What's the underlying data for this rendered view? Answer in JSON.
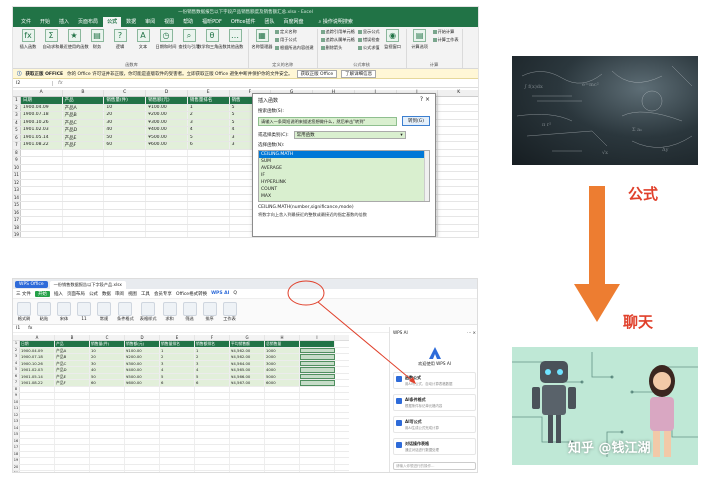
{
  "excel": {
    "title": "一份销售数据报告以下字段产品销售额度及销售额汇总.xlsx - Excel",
    "tabs": [
      "文件",
      "开始",
      "插入",
      "页面布局",
      "公式",
      "数据",
      "审阅",
      "视图",
      "帮助",
      "福昕PDF",
      "Office插件",
      "团队",
      "百度网盘"
    ],
    "active_tab": "公式",
    "search_label": "操作说明搜索",
    "ribbon": {
      "big_buttons": [
        {
          "icon": "fx",
          "label": "插入函数"
        },
        {
          "icon": "Σ",
          "label": "自动求和"
        },
        {
          "icon": "★",
          "label": "最近使用的函数"
        },
        {
          "icon": "▤",
          "label": "财务"
        },
        {
          "icon": "?",
          "label": "逻辑"
        },
        {
          "icon": "A",
          "label": "文本"
        },
        {
          "icon": "◷",
          "label": "日期和时间"
        },
        {
          "icon": "⌕",
          "label": "查找与引用"
        },
        {
          "icon": "θ",
          "label": "数学和三角函数"
        },
        {
          "icon": "…",
          "label": "其他函数"
        }
      ],
      "library_group": "函数库",
      "name_manager": "名称管理器",
      "defined_names": [
        "定义名称",
        "用于公式",
        "根据所选内容创建"
      ],
      "defined_group": "定义的名称",
      "auditing": [
        "追踪引用单元格",
        "追踪从属单元格",
        "删除箭头",
        "显示公式",
        "错误检查",
        "公式求值"
      ],
      "audit_group": "公式审核",
      "watch": "监视窗口",
      "calc": [
        "计算选项",
        "开始计算",
        "计算工作表"
      ],
      "calc_group": "计算"
    },
    "warning": {
      "title": "获取正版 OFFICE",
      "text": "你的 Office 许可证并非正版，你可能是盗版软件的受害者。立即获取正版 Office 避免中断并保护你的文件安全。",
      "btn1": "获取正版 Office",
      "btn2": "了解详细信息"
    },
    "namebox": "I2",
    "fx": "fx",
    "columns": [
      "A",
      "B",
      "C",
      "D",
      "E",
      "F",
      "G",
      "H",
      "I",
      "J",
      "K"
    ],
    "header": [
      "日期",
      "产品",
      "销售量(件)",
      "销售额(元)",
      "销售量排名",
      "销售",
      "",
      "",
      "",
      "",
      ""
    ],
    "rows": [
      [
        "1900.04.09",
        "产品A",
        "10",
        "¥100.00",
        "1",
        "5",
        "",
        "",
        "",
        "",
        ""
      ],
      [
        "1900.07.18",
        "产品B",
        "20",
        "¥200.00",
        "2",
        "5",
        "",
        "",
        "",
        "",
        ""
      ],
      [
        "1900.10.26",
        "产品C",
        "30",
        "¥300.00",
        "3",
        "5",
        "",
        "",
        "",
        "",
        ""
      ],
      [
        "1901.02.03",
        "产品D",
        "40",
        "¥400.00",
        "4",
        "4",
        "",
        "",
        "",
        "",
        ""
      ],
      [
        "1901.05.14",
        "产品E",
        "50",
        "¥500.00",
        "5",
        "3",
        "",
        "",
        "",
        "",
        ""
      ],
      [
        "1901.08.22",
        "产品F",
        "60",
        "¥600.00",
        "6",
        "3",
        "",
        "",
        "",
        "",
        ""
      ]
    ],
    "empty_row_labels": [
      "8",
      "9",
      "10",
      "11",
      "12",
      "13",
      "14",
      "15",
      "16",
      "17",
      "18",
      "19",
      "20"
    ]
  },
  "insert_function": {
    "title": "插入函数",
    "close": "?  ×",
    "search_label": "搜索函数(S):",
    "search_value": "请输入一条简短说明来描述您想做什么，然后单击\"转到\"",
    "go": "转到(G)",
    "category_label": "或选择类别(C):",
    "category_value": "常用函数",
    "list_label": "选择函数(N):",
    "functions": [
      "CEILING.MATH",
      "SUM",
      "AVERAGE",
      "IF",
      "HYPERLINK",
      "COUNT",
      "MAX"
    ],
    "selected_index": 0,
    "signature": "CEILING.MATH(number,significance,mode)",
    "description": "将数字向上舍入到最接近的整数或最接近的指定基数的倍数"
  },
  "labels": {
    "formula": "公式",
    "chat": "聊天"
  },
  "watermark": "知乎 @钱江湖",
  "wps": {
    "tabs": [
      "WPS Office",
      "一份销售数据报告以下字段产品.xlsx"
    ],
    "menu": [
      "三 文件",
      "开始",
      "插入",
      "页面布局",
      "公式",
      "数据",
      "审阅",
      "视图",
      "工具",
      "会员专享",
      "Office格式转换",
      "WPS AI",
      "Q"
    ],
    "active_menu": "开始",
    "toolbar_labels": [
      "格式刷",
      "粘贴",
      "宋体",
      "11",
      "常规",
      "条件格式",
      "表格样式",
      "求和",
      "筛选",
      "排序",
      "工作表"
    ],
    "namebox": "I1",
    "fx": "fx",
    "columns": [
      "A",
      "B",
      "C",
      "D",
      "E",
      "F",
      "G",
      "H",
      "I"
    ],
    "header": [
      "日期",
      "产品",
      "销售量(件)",
      "销售额(元)",
      "销售量排名",
      "销售额排名",
      "平均销售额",
      "总销售量",
      ""
    ],
    "rows": [
      [
        "1900.04.09",
        "产品A",
        "10",
        "¥100.00",
        "1",
        "1",
        "¥4,562.00",
        "1000",
        ""
      ],
      [
        "1900.07.18",
        "产品B",
        "20",
        "¥200.00",
        "2",
        "2",
        "¥4,562.00",
        "2000",
        ""
      ],
      [
        "1900.10.26",
        "产品C",
        "30",
        "¥300.00",
        "3",
        "3",
        "¥4,564.00",
        "3000",
        ""
      ],
      [
        "1901.02.03",
        "产品D",
        "40",
        "¥400.00",
        "4",
        "4",
        "¥4,565.00",
        "4000",
        ""
      ],
      [
        "1901.05.14",
        "产品E",
        "50",
        "¥500.00",
        "5",
        "5",
        "¥4,566.00",
        "5000",
        ""
      ],
      [
        "1901.08.22",
        "产品F",
        "60",
        "¥600.00",
        "6",
        "6",
        "¥4,567.00",
        "6000",
        ""
      ]
    ],
    "empty_row_labels": [
      "8",
      "9",
      "10",
      "11",
      "12",
      "13",
      "14",
      "15",
      "16",
      "17",
      "18",
      "19",
      "20",
      "21",
      "22",
      "23",
      "24",
      "25"
    ]
  },
  "wps_ai": {
    "title": "WPS AI",
    "controls": "⋯  ×",
    "welcome": "欢迎使用 WPS AI",
    "cards": [
      {
        "title": "函数公式",
        "desc": "用AI写公式，自动计算表格数据"
      },
      {
        "title": "AI条件格式",
        "desc": "根据条件标记单元格内容"
      },
      {
        "title": "AI写公式",
        "desc": "用AI生成公式完成计算"
      },
      {
        "title": "对话操作表格",
        "desc": "通过对话进行数据处理"
      }
    ],
    "input_placeholder": "请输入你想进行的操作…"
  },
  "colors": {
    "excel_green": "#217346",
    "data_fill": "#e2efda",
    "accent_red": "#e0402b",
    "arrow_orange": "#ed7d31",
    "wps_blue": "#2e6bd9"
  }
}
